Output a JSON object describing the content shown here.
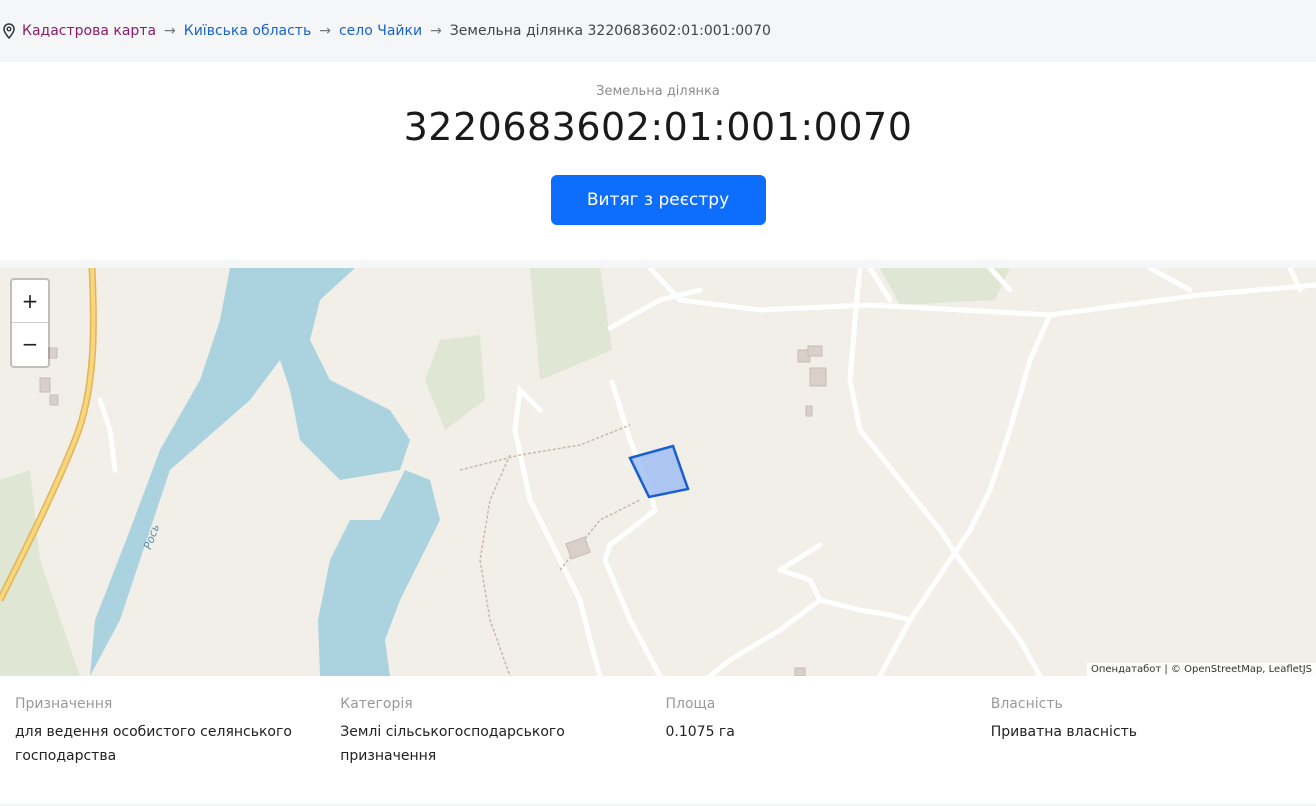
{
  "breadcrumb": {
    "icon": "location-pin-icon",
    "items": [
      "Кадастрова карта",
      "Київська область",
      "село Чайки"
    ],
    "separator": "→",
    "current": "Земельна ділянка 3220683602:01:001:0070"
  },
  "header": {
    "subtitle": "Земельна ділянка",
    "title": "3220683602:01:001:0070",
    "button_label": "Витяг з реєстру"
  },
  "map": {
    "zoom_in": "+",
    "zoom_out": "−",
    "river_label": "Рось",
    "attribution": "Опендатабот | © OpenStreetMap, LeafletJS",
    "colors": {
      "water": "#aad3df",
      "land": "#f2efe9",
      "road": "#ffffff",
      "highway": "#f6c86b",
      "parcel_fill": "#9bbcf2",
      "parcel_stroke": "#1a5fd1"
    }
  },
  "info": {
    "purpose": {
      "label": "Призначення",
      "value": "для ведення особистого селянського господарства"
    },
    "category": {
      "label": "Категорія",
      "value": "Землі сільськогосподарського призначення"
    },
    "area": {
      "label": "Площа",
      "value": "0.1075 га"
    },
    "ownership": {
      "label": "Власність",
      "value": "Приватна власність"
    }
  }
}
